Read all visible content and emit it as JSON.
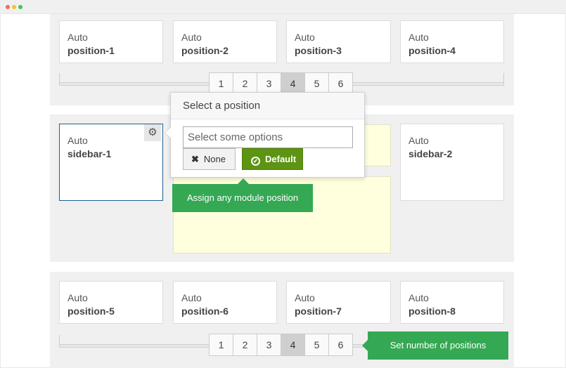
{
  "window": {
    "controls": [
      "close",
      "minimize",
      "maximize"
    ]
  },
  "top_row": {
    "cards": [
      {
        "mode": "Auto",
        "position": "position-1"
      },
      {
        "mode": "Auto",
        "position": "position-2"
      },
      {
        "mode": "Auto",
        "position": "position-3"
      },
      {
        "mode": "Auto",
        "position": "position-4"
      }
    ],
    "pager": {
      "numbers": [
        "1",
        "2",
        "3",
        "4",
        "5",
        "6"
      ],
      "active": "4"
    }
  },
  "middle_row": {
    "left_card": {
      "mode": "Auto",
      "position": "sidebar-1"
    },
    "right_card": {
      "mode": "Auto",
      "position": "sidebar-2"
    },
    "gear_icon": "gear-icon"
  },
  "popover": {
    "title": "Select a position",
    "placeholder": "Select some options",
    "none_label": "None",
    "default_label": "Default"
  },
  "tooltips": {
    "assign": "Assign any module position",
    "set_number": "Set number of positions"
  },
  "bottom_row": {
    "cards": [
      {
        "mode": "Auto",
        "position": "position-5"
      },
      {
        "mode": "Auto",
        "position": "position-6"
      },
      {
        "mode": "Auto",
        "position": "position-7"
      },
      {
        "mode": "Auto",
        "position": "position-8"
      }
    ],
    "pager": {
      "numbers": [
        "1",
        "2",
        "3",
        "4",
        "5",
        "6"
      ],
      "active": "4"
    }
  },
  "colors": {
    "active_border": "#1f5f8b",
    "default_button": "#5d9412",
    "tooltip": "#34a853",
    "highlight_box": "#ffffdd"
  }
}
